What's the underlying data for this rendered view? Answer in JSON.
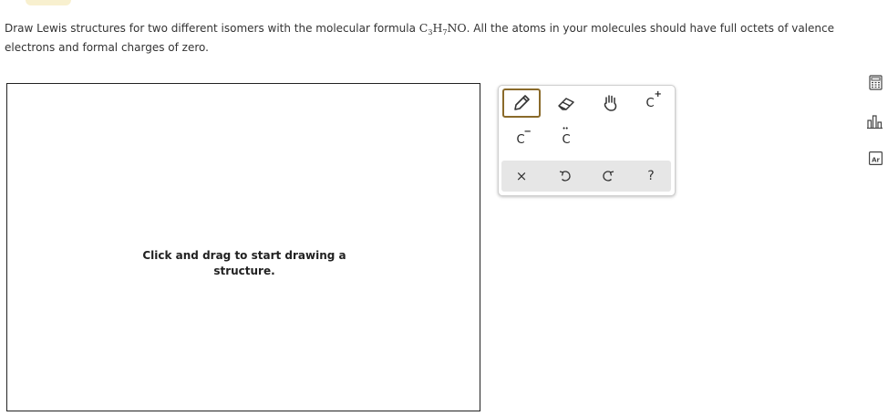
{
  "question": {
    "prefix": "Draw Lewis structures for two different isomers with the molecular formula ",
    "formula": {
      "c": "C",
      "c_sub": "3",
      "h": "H",
      "h_sub": "7",
      "rest": "NO"
    },
    "suffix": ". All the atoms in your molecules should have full octets of valence electrons and formal charges of zero."
  },
  "canvas": {
    "hint": "Click and drag to start drawing a structure."
  },
  "toolbar": {
    "tools": [
      {
        "name": "pencil",
        "icon": "pencil-icon",
        "active": true
      },
      {
        "name": "eraser",
        "icon": "eraser-icon"
      },
      {
        "name": "hand",
        "icon": "hand-icon"
      },
      {
        "name": "positive-charge",
        "label": "C",
        "mark": "+"
      },
      {
        "name": "negative-charge",
        "label": "C",
        "mark": "−"
      },
      {
        "name": "lone-pair",
        "label": "C",
        "mark": "••"
      }
    ],
    "actions": [
      {
        "name": "clear",
        "label": "×"
      },
      {
        "name": "undo",
        "icon": "undo-icon"
      },
      {
        "name": "redo",
        "icon": "redo-icon"
      },
      {
        "name": "help",
        "label": "?"
      }
    ],
    "accent": "#8a6a2a"
  },
  "side_icons": [
    "calculator-icon",
    "bar-chart-icon",
    "periodic-table-icon"
  ],
  "side_labels": {
    "periodic_table": "Ar"
  }
}
